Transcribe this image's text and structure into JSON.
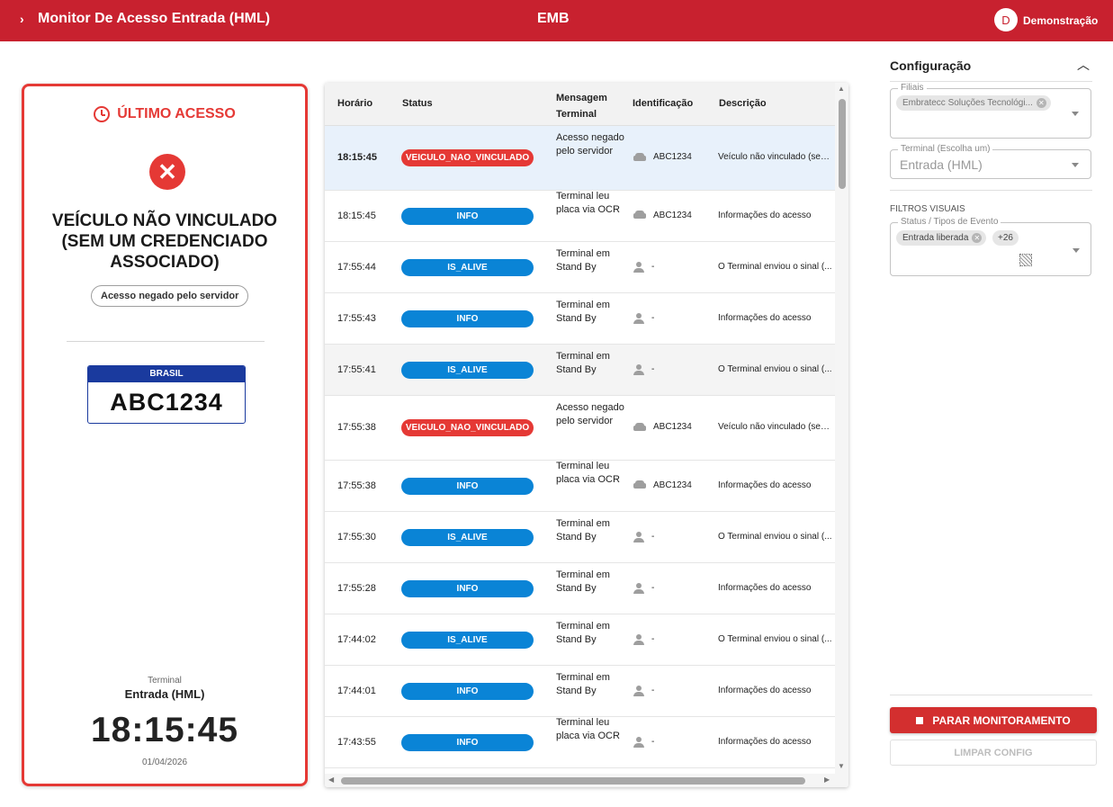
{
  "header": {
    "title": "Monitor De Acesso Entrada (HML)",
    "center_code": "EMB",
    "user_initial": "D",
    "user_name": "Demonstração",
    "bg_color": "#c8212f"
  },
  "last_access": {
    "heading": "ÚLTIMO ACESSO",
    "status_icon": "error-circle-icon",
    "message": "VEÍCULO NÃO VINCULADO (SEM UM CREDENCIADO ASSOCIADO)",
    "server_chip": "Acesso negado pelo servidor",
    "plate_country": "BRASIL",
    "plate_number": "ABC1234",
    "terminal_label": "Terminal",
    "terminal_value": "Entrada (HML)",
    "time": "18:15:45",
    "date": "01/04/2026"
  },
  "table": {
    "columns": [
      "Horário",
      "Status",
      "Mensagem Terminal",
      "Identificação",
      "Descrição"
    ],
    "status_colors": {
      "VEICULO_NAO_VINCULADO": "#e53935",
      "INFO": "#0a84d6",
      "IS_ALIVE": "#0a84d6"
    },
    "rows": [
      {
        "time": "18:15:45",
        "status": "VEICULO_NAO_VINCULADO",
        "message": "Acesso negado pelo servidor",
        "id_icon": "car-icon",
        "id": "ABC1234",
        "desc": "Veículo não vinculado (sem um credenciado associado)"
      },
      {
        "time": "18:15:45",
        "status": "INFO",
        "message": "Terminal leu placa via OCR",
        "id_icon": "car-icon",
        "id": "ABC1234",
        "desc": "Informações do acesso"
      },
      {
        "time": "17:55:44",
        "status": "IS_ALIVE",
        "message": "Terminal em Stand By",
        "id_icon": "person-icon",
        "id": "-",
        "desc": "O Terminal enviou o sinal (..."
      },
      {
        "time": "17:55:43",
        "status": "INFO",
        "message": "Terminal em Stand By",
        "id_icon": "person-icon",
        "id": "-",
        "desc": "Informações do acesso"
      },
      {
        "time": "17:55:41",
        "status": "IS_ALIVE",
        "message": "Terminal em Stand By",
        "id_icon": "person-icon",
        "id": "-",
        "desc": "O Terminal enviou o sinal (..."
      },
      {
        "time": "17:55:38",
        "status": "VEICULO_NAO_VINCULADO",
        "message": "Acesso negado pelo servidor",
        "id_icon": "car-icon",
        "id": "ABC1234",
        "desc": "Veículo não vinculado (sem um credenciado associado)"
      },
      {
        "time": "17:55:38",
        "status": "INFO",
        "message": "Terminal leu placa via OCR",
        "id_icon": "car-icon",
        "id": "ABC1234",
        "desc": "Informações do acesso"
      },
      {
        "time": "17:55:30",
        "status": "IS_ALIVE",
        "message": "Terminal em Stand By",
        "id_icon": "person-icon",
        "id": "-",
        "desc": "O Terminal enviou o sinal (..."
      },
      {
        "time": "17:55:28",
        "status": "INFO",
        "message": "Terminal em Stand By",
        "id_icon": "person-icon",
        "id": "-",
        "desc": "Informações do acesso"
      },
      {
        "time": "17:44:02",
        "status": "IS_ALIVE",
        "message": "Terminal em Stand By",
        "id_icon": "person-icon",
        "id": "-",
        "desc": "O Terminal enviou o sinal (..."
      },
      {
        "time": "17:44:01",
        "status": "INFO",
        "message": "Terminal em Stand By",
        "id_icon": "person-icon",
        "id": "-",
        "desc": "Informações do acesso"
      },
      {
        "time": "17:43:55",
        "status": "INFO",
        "message": "Terminal leu placa via OCR",
        "id_icon": "person-icon",
        "id": "-",
        "desc": "Informações do acesso"
      }
    ]
  },
  "config": {
    "title": "Configuração",
    "filiais_label": "Filiais",
    "filiais_chip": "Embratecc Soluções Tecnológi...",
    "terminal_label": "Terminal (Escolha um)",
    "terminal_value": "Entrada (HML)",
    "filters_title": "FILTROS VISUAIS",
    "status_label": "Status / Tipos de Evento",
    "status_chip": "Entrada liberada",
    "status_more": "+26",
    "stop_button": "PARAR MONITORAMENTO",
    "clear_button": "LIMPAR CONFIG"
  }
}
